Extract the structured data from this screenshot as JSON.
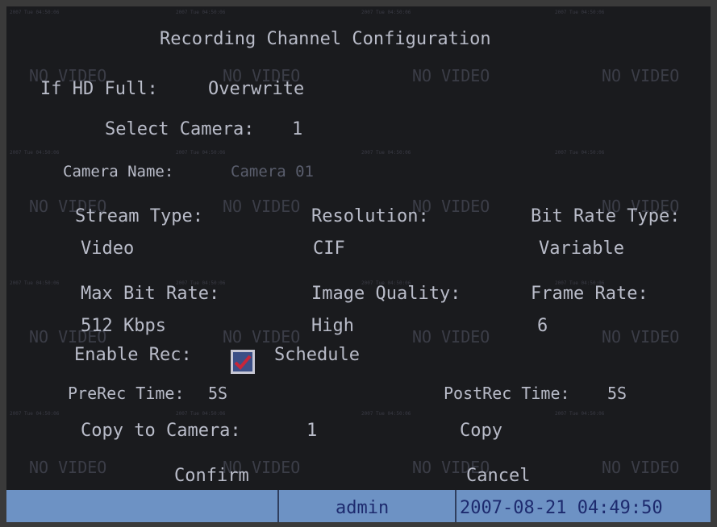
{
  "title": "Recording Channel Configuration",
  "overwrite": {
    "label": "If HD Full:",
    "value": "Overwrite"
  },
  "camera": {
    "label": "Select Camera:",
    "value": "1"
  },
  "camera_name": {
    "label": "Camera Name:",
    "value": "Camera 01"
  },
  "stream_type": {
    "label": "Stream Type:",
    "value": "Video"
  },
  "resolution": {
    "label": "Resolution:",
    "value": "CIF"
  },
  "bit_rate_type": {
    "label": "Bit Rate Type:",
    "value": "Variable"
  },
  "max_bit_rate": {
    "label": "Max Bit Rate:",
    "value": "512 Kbps"
  },
  "image_quality": {
    "label": "Image Quality:",
    "value": "High"
  },
  "frame_rate": {
    "label": "Frame Rate:",
    "value": "6"
  },
  "enable_rec": {
    "label": "Enable Rec:",
    "checked": true,
    "schedule_label": "Schedule"
  },
  "prerec": {
    "label": "PreRec Time:",
    "value": "5S"
  },
  "postrec": {
    "label": "PostRec Time:",
    "value": "5S"
  },
  "copy_to": {
    "label": "Copy to Camera:",
    "value": "1",
    "copy_label": "Copy"
  },
  "buttons": {
    "confirm": "Confirm",
    "cancel": "Cancel"
  },
  "status": {
    "user": "admin",
    "datetime": "2007-08-21 04:49:50"
  },
  "background": {
    "no_video": "NO VIDEO",
    "timestamp": "2007 Tue 04:50:06"
  },
  "colors": {
    "accent": "#6d92c4",
    "text": "#b9bcc9",
    "check": "#c8263a"
  }
}
